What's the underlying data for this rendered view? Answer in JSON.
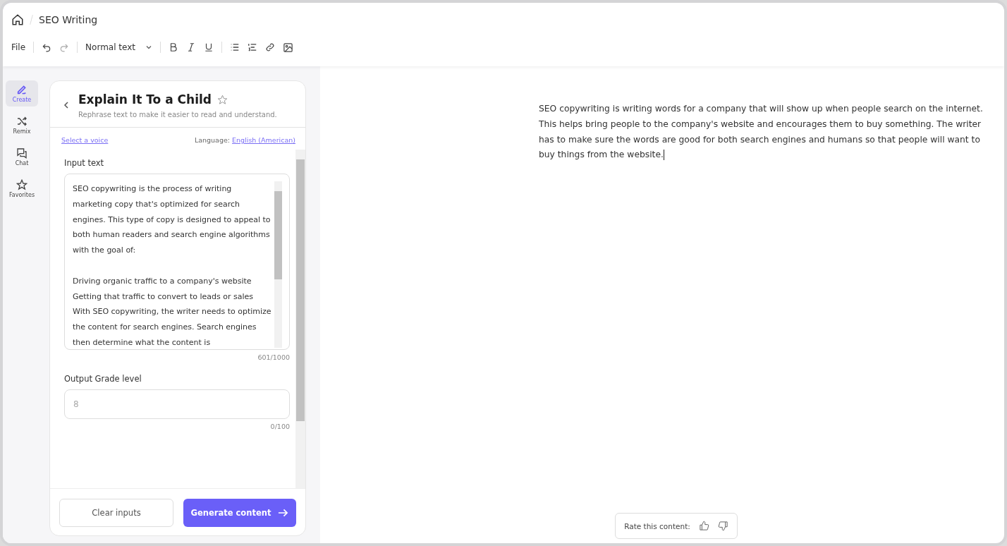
{
  "breadcrumb": {
    "title": "SEO Writing"
  },
  "toolbar": {
    "file_menu": "File",
    "text_style": "Normal text"
  },
  "nav": [
    {
      "label": "Create",
      "selected": true
    },
    {
      "label": "Remix",
      "selected": false
    },
    {
      "label": "Chat",
      "selected": false
    },
    {
      "label": "Favorites",
      "selected": false
    }
  ],
  "panel": {
    "title": "Explain It To a Child",
    "favorited": false,
    "subtitle": "Rephrase text to make it easier to read and understand.",
    "voice_link": "Select a voice",
    "language_label": "Language:",
    "language": "English (American)",
    "input_label": "Input text",
    "input_value": "SEO copywriting is the process of writing marketing copy that's optimized for search engines. This type of copy is designed to appeal to both human readers and search engine algorithms with the goal of:\n\nDriving organic traffic to a company's website\nGetting that traffic to convert to leads or sales\nWith SEO copywriting, the writer needs to optimize the content for search engines. Search engines then determine what the content is",
    "input_count": "601/1000",
    "grade_label": "Output Grade level",
    "grade_placeholder": "8",
    "grade_count": "0/100",
    "clear_button": "Clear inputs",
    "generate_button": "Generate content"
  },
  "output": {
    "text": " SEO copywriting is writing words for a company that will show up when people search on the internet. This helps bring people to the company's website and encourages them to buy something. The writer has to make sure the words are good for both search engines and humans so that people will want to buy things from the website.",
    "rate_label": "Rate this content:"
  }
}
